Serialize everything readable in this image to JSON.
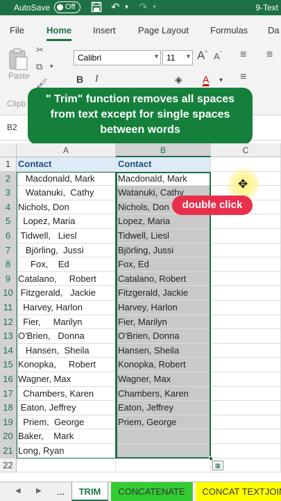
{
  "titlebar": {
    "autosave_label": "AutoSave",
    "toggle_state": "Off",
    "filename": "9-Text"
  },
  "ribbon_tabs": [
    "File",
    "Home",
    "Insert",
    "Page Layout",
    "Formulas",
    "Da"
  ],
  "ribbon": {
    "paste_label": "Paste",
    "clipboard_label": "Clipb",
    "font_name": "Calibri",
    "font_size": "11",
    "bold": "B",
    "italic": "I",
    "grow_font": "A",
    "shrink_font": "A",
    "font_color_letter": "A"
  },
  "callout_text": "\" Trim\" function removes all spaces from text except for single spaces between words",
  "name_box": "B2",
  "columns": [
    "A",
    "B",
    "C"
  ],
  "rows": [
    {
      "n": "1",
      "a": "Contact",
      "b": "Contact"
    },
    {
      "n": "2",
      "a": "   Macdonald, Mark",
      "b": "Macdonald, Mark"
    },
    {
      "n": "3",
      "a": "   Watanuki,  Cathy",
      "b": "Watanuki, Cathy"
    },
    {
      "n": "4",
      "a": "Nichols, Don",
      "b": "Nichols, Don"
    },
    {
      "n": "5",
      "a": "  Lopez, Maria",
      "b": "Lopez, Maria"
    },
    {
      "n": "6",
      "a": " Tidwell,   Liesl",
      "b": "Tidwell, Liesl"
    },
    {
      "n": "7",
      "a": "   Björling,  Jussi",
      "b": "Björling, Jussi"
    },
    {
      "n": "8",
      "a": "     Fox,    Ed",
      "b": "Fox, Ed"
    },
    {
      "n": "9",
      "a": "Catalano,     Robert",
      "b": "Catalano, Robert"
    },
    {
      "n": "10",
      "a": " Fitzgerald,   Jackie",
      "b": "Fitzgerald, Jackie"
    },
    {
      "n": "11",
      "a": "  Harvey, Harlon",
      "b": "Harvey, Harlon"
    },
    {
      "n": "12",
      "a": "  Fier,     Marilyn",
      "b": "Fier, Marilyn"
    },
    {
      "n": "13",
      "a": "O'Brien,   Donna",
      "b": "O'Brien, Donna"
    },
    {
      "n": "14",
      "a": "   Hansen,  Sheila",
      "b": "Hansen, Sheila"
    },
    {
      "n": "15",
      "a": "Konopka,     Robert",
      "b": "Konopka, Robert"
    },
    {
      "n": "16",
      "a": "Wagner, Max",
      "b": "Wagner, Max"
    },
    {
      "n": "17",
      "a": "  Chambers, Karen",
      "b": "Chambers, Karen"
    },
    {
      "n": "18",
      "a": " Eaton, Jeffrey",
      "b": "Eaton, Jeffrey"
    },
    {
      "n": "19",
      "a": "  Priem,  George",
      "b": "Priem, George"
    },
    {
      "n": "20",
      "a": "Baker,    Mark",
      "b": ""
    },
    {
      "n": "21",
      "a": "Long, Ryan",
      "b": ""
    },
    {
      "n": "22",
      "a": "",
      "b": ""
    }
  ],
  "double_click_label": "double click",
  "sheet_tabs": [
    {
      "label": "...",
      "color": "#f0f0f0"
    },
    {
      "label": "TRIM",
      "color": "#ffffff"
    },
    {
      "label": "CONCATENATE",
      "color": "#33cc33"
    },
    {
      "label": "CONCAT TEXTJOIN",
      "color": "#ffff00"
    }
  ],
  "colors": {
    "excel_green": "#1e7145",
    "callout_green": "#14803c",
    "badge_red": "#e8304d"
  }
}
